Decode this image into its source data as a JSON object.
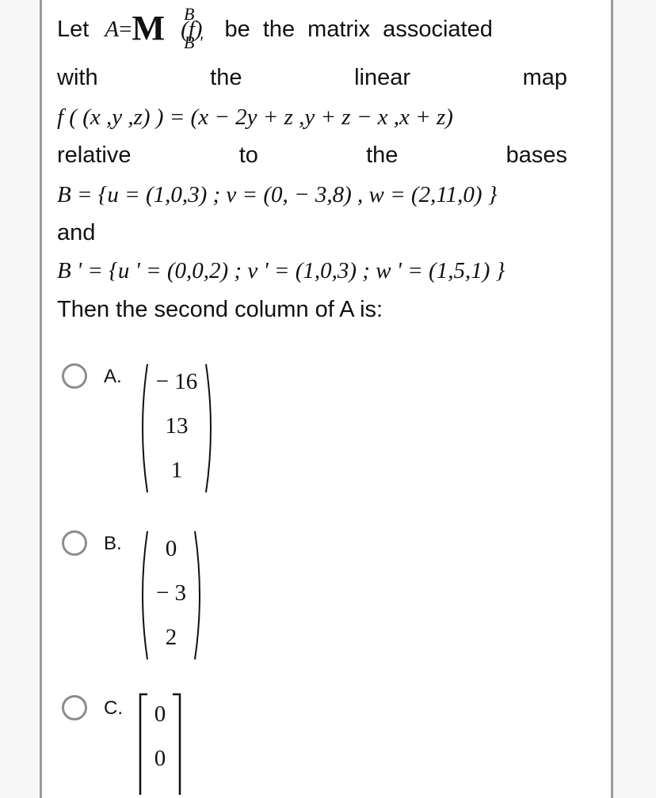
{
  "question": {
    "line1": {
      "let": "Let",
      "A": "A",
      "eq": "=",
      "M": "M",
      "sup": "B",
      "sub": "B '",
      "arg": "(f)",
      "rest": "be the matrix associated"
    },
    "line2_words": [
      "with",
      "the",
      "linear",
      "map"
    ],
    "map_def": "f ( (x ,y ,z) ) =  (x − 2y + z ,y + z − x ,x + z)",
    "line4_words": [
      "relative",
      "to",
      "the",
      "bases"
    ],
    "basis_B": "B = {u = (1,0,3) ; v = (0, − 3,8) , w = (2,11,0) }",
    "and": "and",
    "basis_Bprime": "B ' = {u ' = (0,0,2) ; v ' = (1,0,3) ; w ' = (1,5,1) }",
    "prompt": "Then the second column of A  is:"
  },
  "options": [
    {
      "label": "A.",
      "bracket": "paren",
      "entries": [
        "− 16",
        "13",
        "1"
      ]
    },
    {
      "label": "B.",
      "bracket": "paren",
      "entries": [
        "0",
        "− 3",
        "2"
      ]
    },
    {
      "label": "C.",
      "bracket": "square",
      "entries": [
        "0",
        "0"
      ]
    }
  ]
}
